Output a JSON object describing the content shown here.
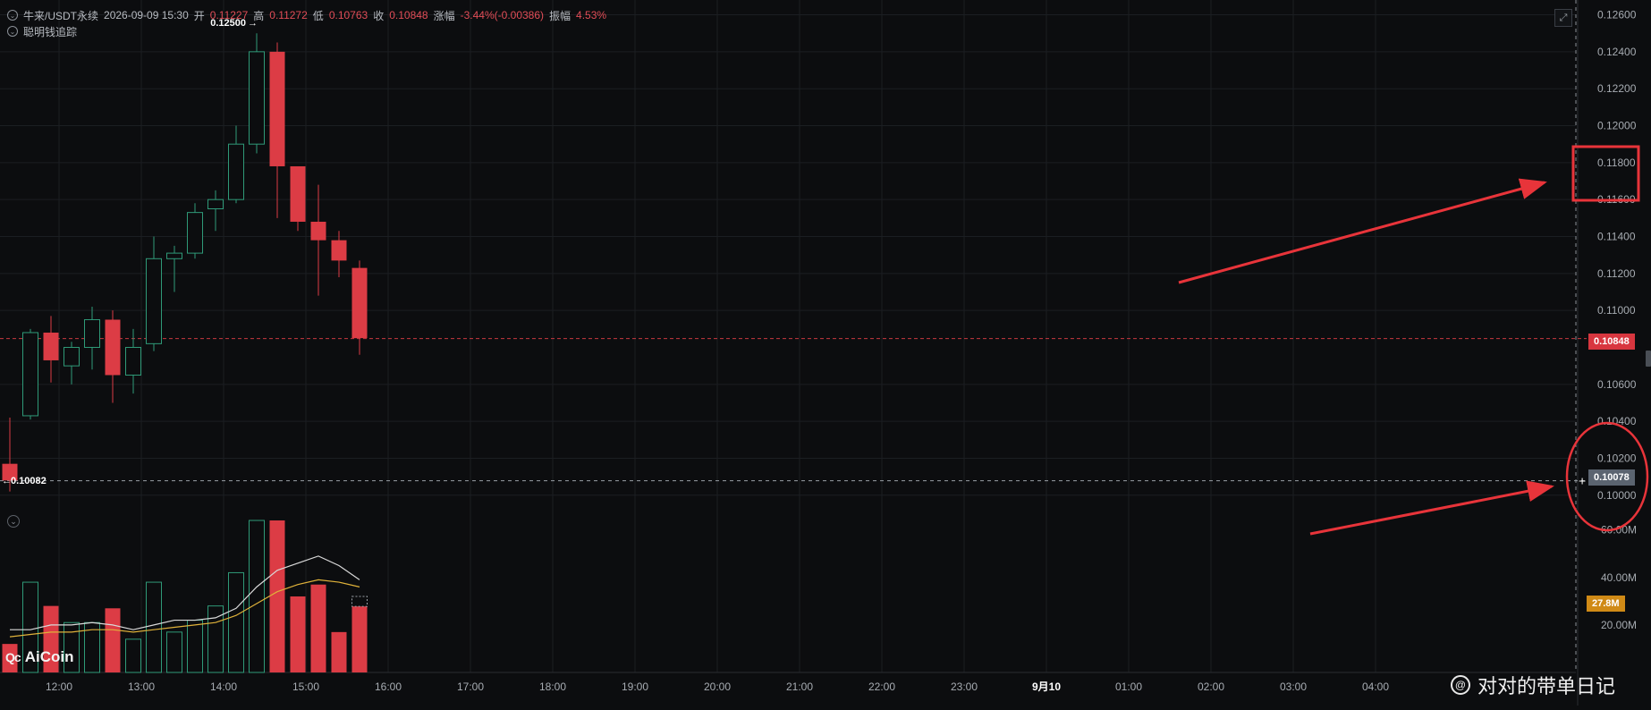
{
  "header": {
    "symbol": "牛来/USDT永续",
    "datetime": "2026-09-09 15:30",
    "open_label": "开",
    "open_value": "0.11227",
    "high_label": "高",
    "high_value": "0.11272",
    "low_label": "低",
    "low_value": "0.10763",
    "close_label": "收",
    "close_value": "0.10848",
    "change_label": "涨幅",
    "change_value": "-3.44%(-0.00386)",
    "amplitude_label": "振幅",
    "amplitude_value": "4.53%",
    "indicator_name": "聪明钱追踪"
  },
  "annotations": {
    "high_marker": "0.12500",
    "low_marker": "0.10082"
  },
  "badges": {
    "last_price": "0.10848",
    "crosshair_price": "0.10078",
    "volume_now": "27.8M"
  },
  "logo": {
    "mark": "Qc",
    "text": "AiCoin"
  },
  "watermark": {
    "text": "对对的带单日记"
  },
  "colors": {
    "up": "#2f9a78",
    "down": "#dc3c45",
    "background": "#0c0d0f",
    "grid": "#1b1e22",
    "ma_white": "#d9d9d9",
    "ma_yellow": "#e0b23a",
    "arrow": "#e8343a",
    "last_price_badge": "#d8363f",
    "crosshair_badge": "#5b6470",
    "volume_badge": "#d08a16"
  },
  "chart_data": {
    "type": "candlestick",
    "price_axis": {
      "ticks": [
        "0.12600",
        "0.12400",
        "0.12200",
        "0.12000",
        "0.11800",
        "0.11600",
        "0.11400",
        "0.11200",
        "0.11000",
        "0.10600",
        "0.10400",
        "0.10200",
        "0.10000"
      ],
      "ylim": [
        0.0997,
        0.1268
      ]
    },
    "volume_axis": {
      "ticks": [
        "60.00M",
        "40.00M",
        "20.00M"
      ],
      "ylim": [
        0,
        64
      ]
    },
    "time_axis": {
      "ticks": [
        "12:00",
        "13:00",
        "14:00",
        "15:00",
        "16:00",
        "17:00",
        "18:00",
        "19:00",
        "20:00",
        "21:00",
        "22:00",
        "23:00",
        "9月10",
        "01:00",
        "02:00",
        "03:00",
        "04:00"
      ]
    },
    "candles": [
      {
        "o": 0.1017,
        "h": 0.1042,
        "l": 0.1002,
        "c": 0.1008,
        "v": 12
      },
      {
        "o": 0.1043,
        "h": 0.109,
        "l": 0.1041,
        "c": 0.1088,
        "v": 38
      },
      {
        "o": 0.1088,
        "h": 0.1097,
        "l": 0.1061,
        "c": 0.1073,
        "v": 28
      },
      {
        "o": 0.107,
        "h": 0.1083,
        "l": 0.106,
        "c": 0.108,
        "v": 21
      },
      {
        "o": 0.108,
        "h": 0.1102,
        "l": 0.1068,
        "c": 0.1095,
        "v": 21
      },
      {
        "o": 0.1095,
        "h": 0.11,
        "l": 0.105,
        "c": 0.1065,
        "v": 27
      },
      {
        "o": 0.1065,
        "h": 0.109,
        "l": 0.1055,
        "c": 0.108,
        "v": 14
      },
      {
        "o": 0.1082,
        "h": 0.114,
        "l": 0.1078,
        "c": 0.1128,
        "v": 38
      },
      {
        "o": 0.1128,
        "h": 0.1135,
        "l": 0.111,
        "c": 0.1131,
        "v": 17
      },
      {
        "o": 0.1131,
        "h": 0.1158,
        "l": 0.1128,
        "c": 0.1153,
        "v": 22
      },
      {
        "o": 0.1155,
        "h": 0.1165,
        "l": 0.1143,
        "c": 0.116,
        "v": 28
      },
      {
        "o": 0.116,
        "h": 0.12,
        "l": 0.1158,
        "c": 0.119,
        "v": 42
      },
      {
        "o": 0.119,
        "h": 0.125,
        "l": 0.1185,
        "c": 0.124,
        "v": 64
      },
      {
        "o": 0.124,
        "h": 0.1245,
        "l": 0.115,
        "c": 0.1178,
        "v": 64
      },
      {
        "o": 0.1178,
        "h": 0.1178,
        "l": 0.1143,
        "c": 0.1148,
        "v": 32
      },
      {
        "o": 0.1148,
        "h": 0.1168,
        "l": 0.1108,
        "c": 0.1138,
        "v": 37
      },
      {
        "o": 0.1138,
        "h": 0.1143,
        "l": 0.1118,
        "c": 0.1127,
        "v": 17
      },
      {
        "o": 0.1123,
        "h": 0.1127,
        "l": 0.1076,
        "c": 0.1085,
        "v": 27.8
      }
    ],
    "ma_white": [
      18,
      18,
      20,
      20,
      21,
      20,
      18,
      20,
      22,
      22,
      23,
      27,
      36,
      43,
      46,
      49,
      45,
      39
    ],
    "ma_yellow": [
      15,
      16,
      17,
      17,
      18,
      18,
      17,
      18,
      19,
      20,
      21,
      24,
      29,
      34,
      37,
      39,
      38,
      36
    ],
    "last_price": 0.10848,
    "crosshair_price": 0.10078,
    "high_marker_price": 0.125,
    "low_marker_price": 0.10082
  }
}
